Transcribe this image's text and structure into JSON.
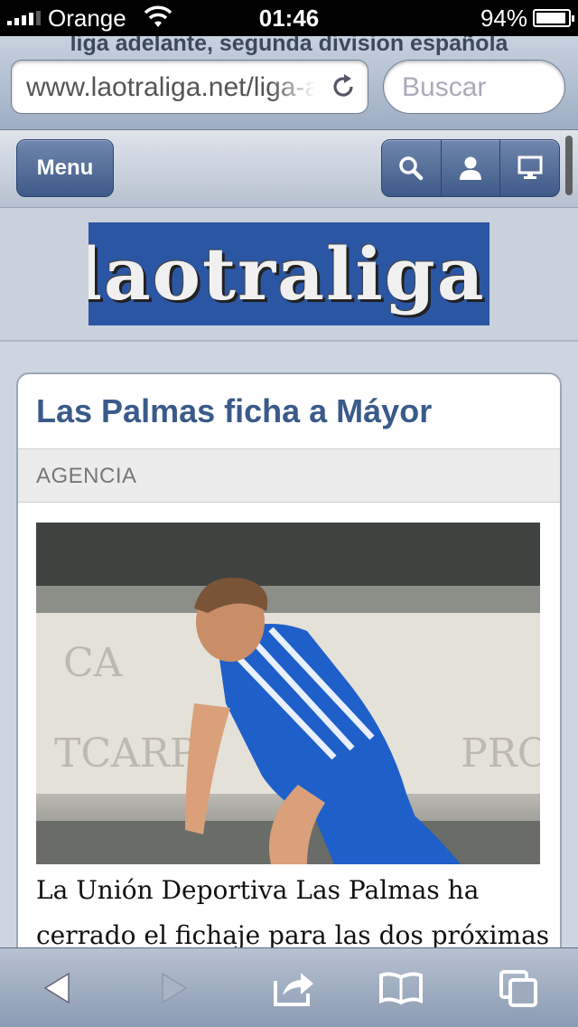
{
  "status_bar": {
    "carrier": "Orange",
    "time": "01:46",
    "battery": "94%",
    "battery_level": 0.94
  },
  "browser": {
    "page_title": "liga adelante, segunda division española",
    "url": "www.laotraliga.net/liga-a",
    "search_placeholder": "Buscar"
  },
  "site_nav": {
    "menu_label": "Menu",
    "icons": [
      "search-icon",
      "user-icon",
      "desktop-icon"
    ]
  },
  "logo": {
    "text": "laotraliga"
  },
  "article": {
    "title": "Las Palmas ficha a Máyor",
    "source": "AGENCIA",
    "body": "La Unión Deportiva Las Palmas ha cerrado el fichaje para las dos próximas"
  },
  "toolbar": {
    "icons": [
      "back-icon",
      "forward-icon",
      "share-icon",
      "bookmarks-icon",
      "tabs-icon"
    ]
  },
  "colors": {
    "accent": "#3f5a88",
    "title": "#3a5a8a"
  }
}
